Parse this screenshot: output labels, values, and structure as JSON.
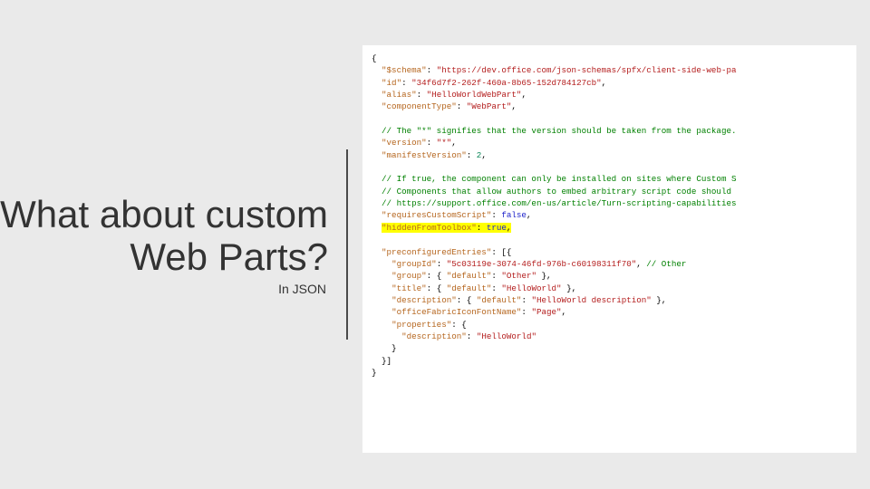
{
  "slide": {
    "title": "What about custom Web Parts?",
    "subtitle": "In JSON"
  },
  "code": {
    "lines": [
      {
        "t": "brace",
        "text": "{"
      },
      {
        "t": "kv",
        "key": "\"$schema\"",
        "val": "\"https://dev.office.com/json-schemas/spfx/client-side-web-pa",
        "trail": ""
      },
      {
        "t": "kv",
        "key": "\"id\"",
        "val": "\"34f6d7f2-262f-460a-8b65-152d784127cb\"",
        "trail": ","
      },
      {
        "t": "kv",
        "key": "\"alias\"",
        "val": "\"HelloWorldWebPart\"",
        "trail": ","
      },
      {
        "t": "kv",
        "key": "\"componentType\"",
        "val": "\"WebPart\"",
        "trail": ","
      },
      {
        "t": "blank"
      },
      {
        "t": "comment",
        "text": "  // The \"*\" signifies that the version should be taken from the package."
      },
      {
        "t": "kv",
        "key": "\"version\"",
        "val": "\"*\"",
        "trail": ","
      },
      {
        "t": "kvnum",
        "key": "\"manifestVersion\"",
        "num": "2",
        "trail": ","
      },
      {
        "t": "blank"
      },
      {
        "t": "comment",
        "text": "  // If true, the component can only be installed on sites where Custom S"
      },
      {
        "t": "comment",
        "text": "  // Components that allow authors to embed arbitrary script code should "
      },
      {
        "t": "comment",
        "text": "  // https://support.office.com/en-us/article/Turn-scripting-capabilities"
      },
      {
        "t": "kvbool",
        "key": "\"requiresCustomScript\"",
        "bool": "false",
        "trail": ","
      },
      {
        "t": "kvbool_hl",
        "key": "\"hiddenFromToolbox\"",
        "bool": "true",
        "trail": ","
      },
      {
        "t": "blank"
      },
      {
        "t": "raw",
        "html": "  <span class='key'>\"preconfiguredEntries\"</span><span class='br'>: [{</span>"
      },
      {
        "t": "raw",
        "html": "    <span class='key'>\"groupId\"</span><span class='br'>: </span><span class='str'>\"5c03119e-3074-46fd-976b-c60198311f70\"</span><span class='br'>, </span><span class='com'>// Other</span>"
      },
      {
        "t": "raw",
        "html": "    <span class='key'>\"group\"</span><span class='br'>: { </span><span class='key'>\"default\"</span><span class='br'>: </span><span class='str'>\"Other\"</span><span class='br'> },</span>"
      },
      {
        "t": "raw",
        "html": "    <span class='key'>\"title\"</span><span class='br'>: { </span><span class='key'>\"default\"</span><span class='br'>: </span><span class='str'>\"HelloWorld\"</span><span class='br'> },</span>"
      },
      {
        "t": "raw",
        "html": "    <span class='key'>\"description\"</span><span class='br'>: { </span><span class='key'>\"default\"</span><span class='br'>: </span><span class='str'>\"HelloWorld description\"</span><span class='br'> },</span>"
      },
      {
        "t": "raw",
        "html": "    <span class='key'>\"officeFabricIconFontName\"</span><span class='br'>: </span><span class='str'>\"Page\"</span><span class='br'>,</span>"
      },
      {
        "t": "raw",
        "html": "    <span class='key'>\"properties\"</span><span class='br'>: {</span>"
      },
      {
        "t": "raw",
        "html": "      <span class='key'>\"description\"</span><span class='br'>: </span><span class='str'>\"HelloWorld\"</span>"
      },
      {
        "t": "brace",
        "text": "    }"
      },
      {
        "t": "brace",
        "text": "  }]"
      },
      {
        "t": "brace",
        "text": "}"
      }
    ]
  }
}
